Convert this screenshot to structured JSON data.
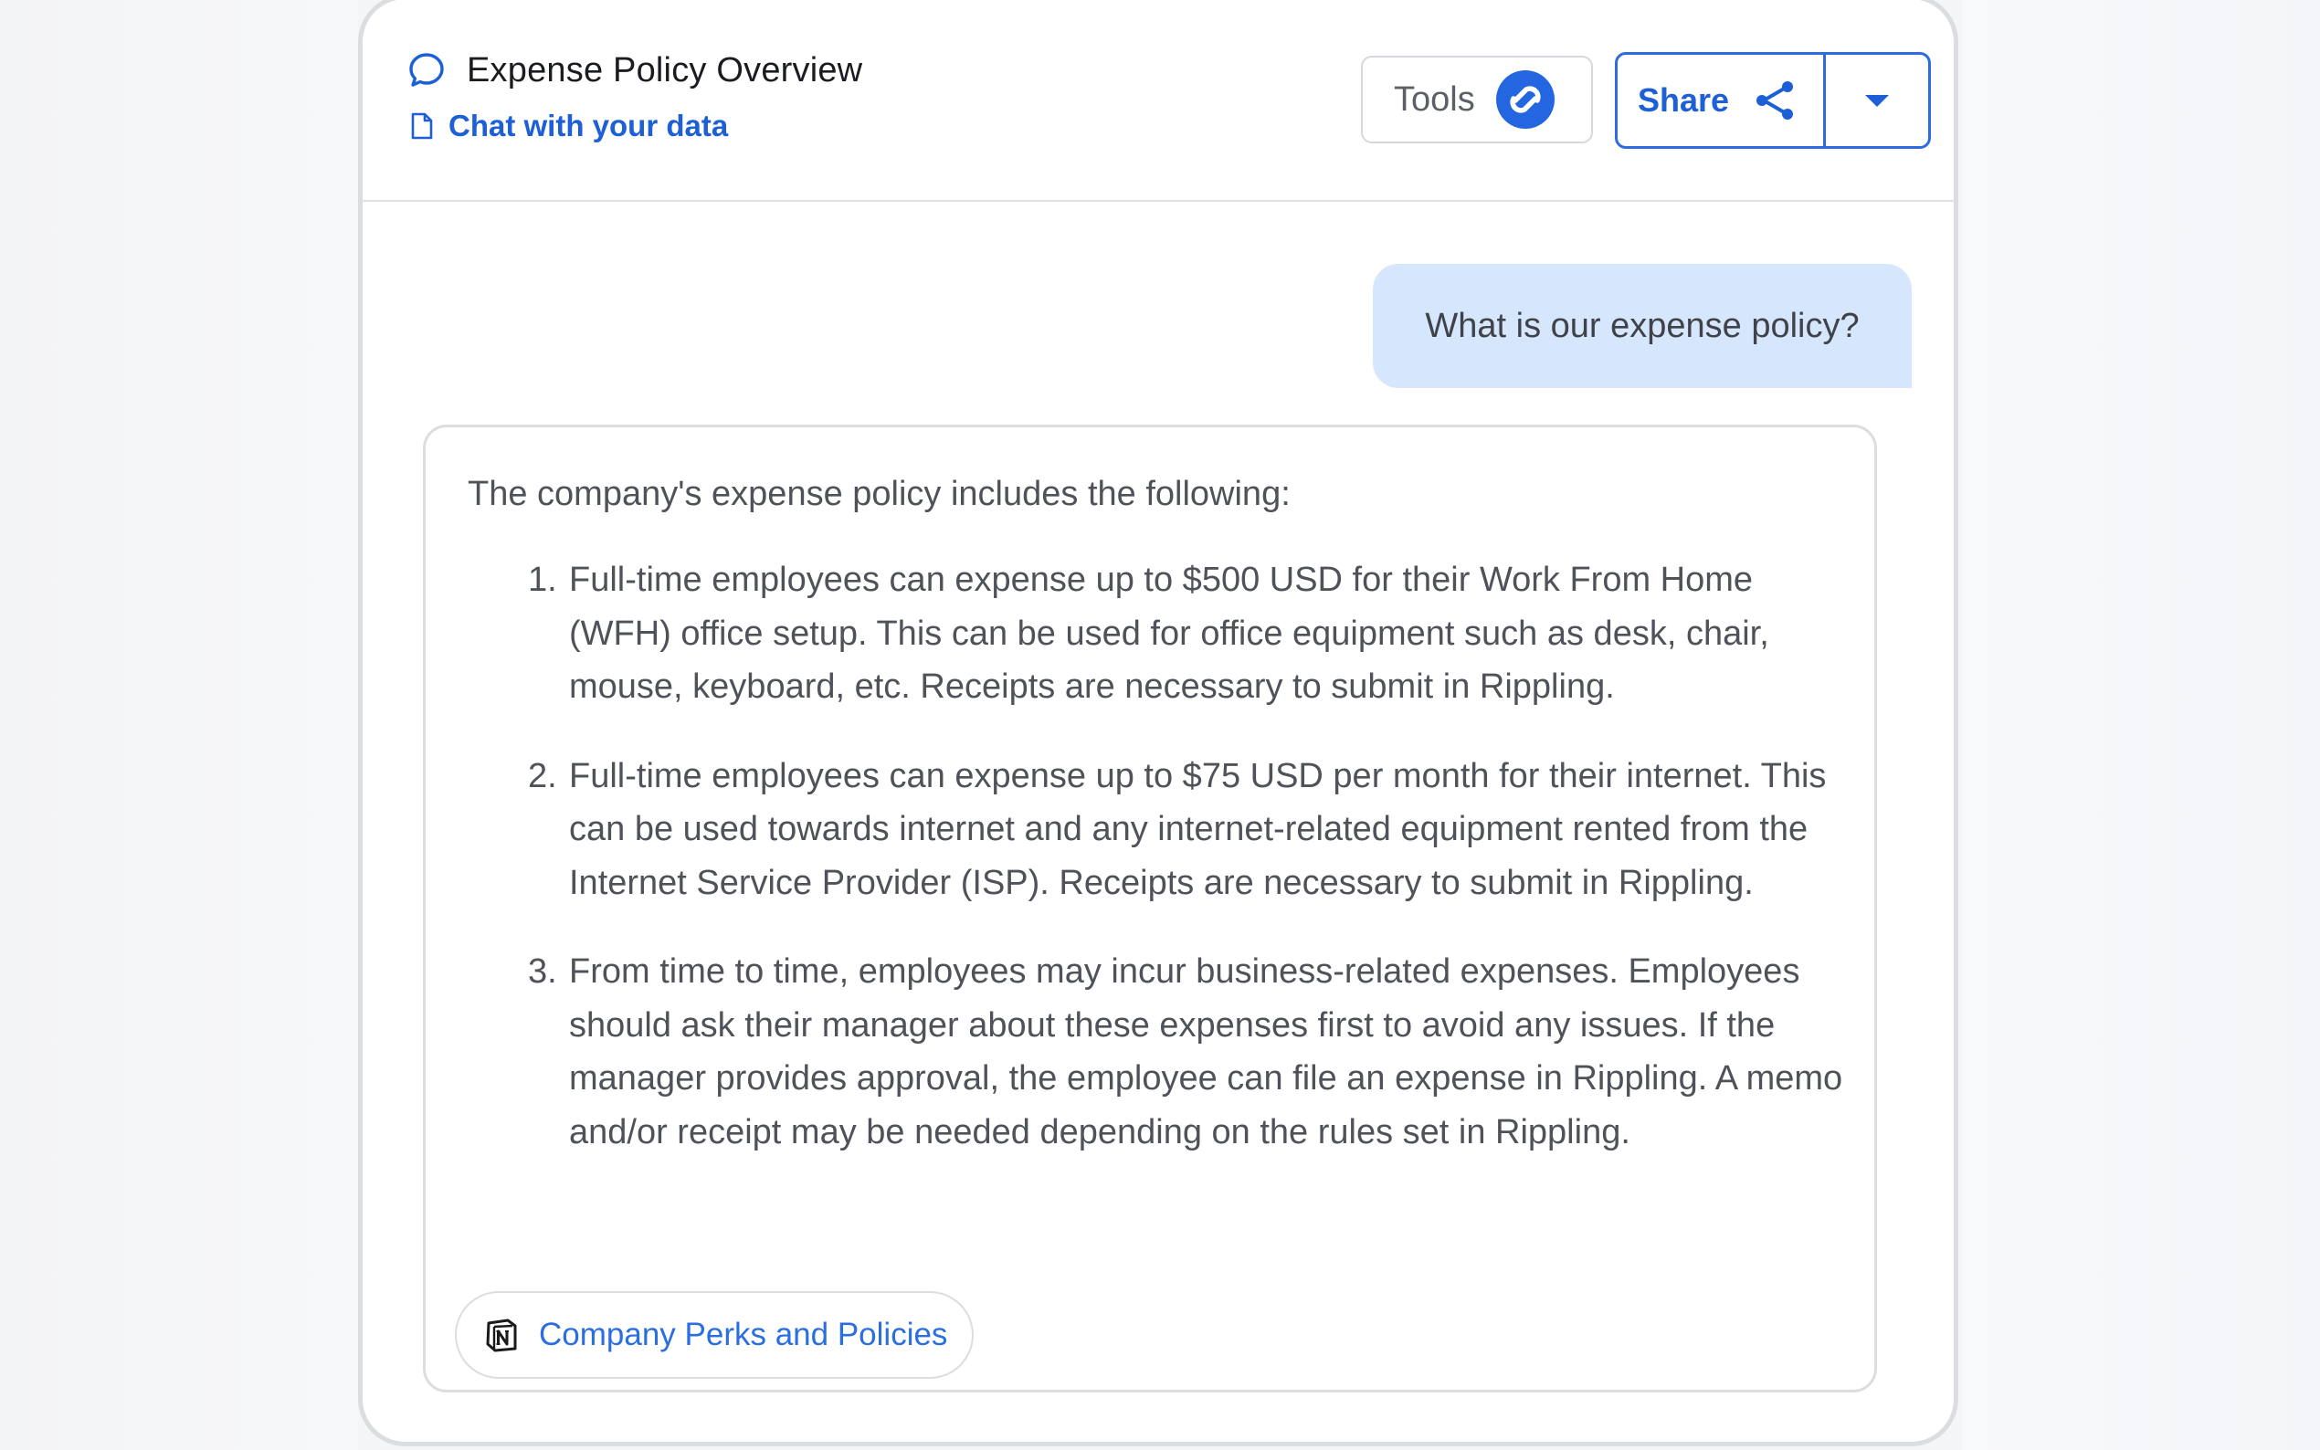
{
  "header": {
    "title": "Expense Policy Overview",
    "subtitle": "Chat with your data",
    "tools_label": "Tools",
    "share_label": "Share"
  },
  "conversation": {
    "user_message": "What is our expense policy?",
    "answer": {
      "intro": "The company's expense policy includes the following:",
      "items": [
        {
          "number": "1.",
          "text": "Full-time employees can expense up to $500 USD for their Work From Home (WFH) office setup. This can be used for office equipment such as desk, chair, mouse, keyboard, etc. Receipts are necessary to submit in Rippling."
        },
        {
          "number": "2.",
          "text": "Full-time employees can expense up to $75 USD per month for their internet. This can be used towards internet and any internet-related equipment rented from the Internet Service Provider (ISP). Receipts are necessary to submit in Rippling."
        },
        {
          "number": "3.",
          "text": "From time to time, employees may incur business-related expenses. Employees should ask their manager about these expenses first to avoid any issues. If the manager provides approval, the employee can file an expense in Rippling. A memo and/or receipt may be needed depending on the rules set in Rippling."
        }
      ],
      "source_label": "Company Perks and Policies"
    }
  },
  "icons": {
    "title_icon": "chat-bubble-icon",
    "subtitle_icon": "document-icon",
    "tools_icon": "tools-logo-icon",
    "share_icon": "share-icon",
    "dropdown_icon": "caret-down-icon",
    "source_icon": "notion-icon"
  },
  "colors": {
    "accent": "#1d5fd6",
    "user_bubble": "#d6e6fd",
    "text": "#4f5359",
    "border": "#dcdde1"
  }
}
